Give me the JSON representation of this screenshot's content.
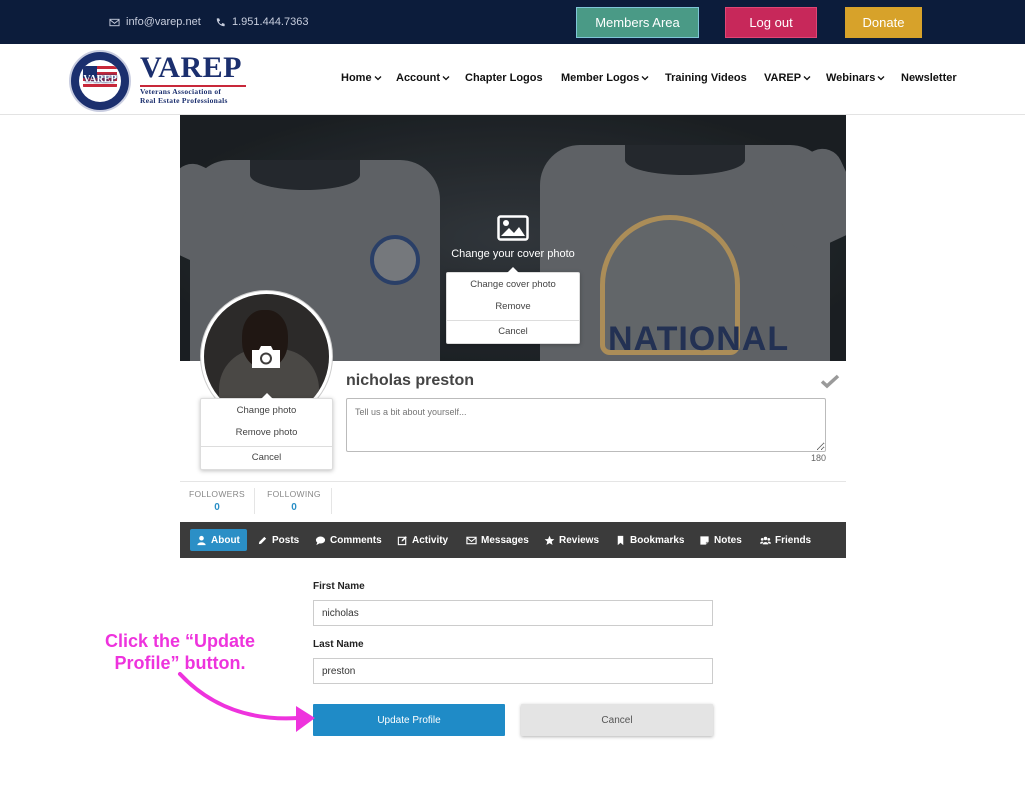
{
  "topbar": {
    "email": "info@varep.net",
    "phone": "1.951.444.7363",
    "members_label": "Members Area",
    "logout_label": "Log out",
    "donate_label": "Donate"
  },
  "logo": {
    "seal_word": "VAREP",
    "wordmark": "VAREP",
    "tagline_1": "Veterans Association of",
    "tagline_2": "Real Estate Professionals"
  },
  "nav": {
    "items": [
      {
        "label": "Home",
        "dropdown": true
      },
      {
        "label": "Account",
        "dropdown": true
      },
      {
        "label": "Chapter Logos",
        "dropdown": false
      },
      {
        "label": "Member Logos",
        "dropdown": true
      },
      {
        "label": "Training Videos",
        "dropdown": false
      },
      {
        "label": "VAREP",
        "dropdown": true
      },
      {
        "label": "Webinars",
        "dropdown": true
      },
      {
        "label": "Newsletter",
        "dropdown": false
      }
    ]
  },
  "cover": {
    "change_text": "Change your cover photo",
    "shirt_text": "NATIONAL",
    "menu": {
      "change": "Change cover photo",
      "remove": "Remove",
      "cancel": "Cancel"
    }
  },
  "photo_menu": {
    "change": "Change photo",
    "remove": "Remove photo",
    "cancel": "Cancel"
  },
  "profile": {
    "name": "nicholas preston",
    "bio_placeholder": "Tell us a bit about yourself...",
    "bio_remaining": "180",
    "followers_label": "FOLLOWERS",
    "followers_count": "0",
    "following_label": "FOLLOWING",
    "following_count": "0"
  },
  "tabs": [
    {
      "label": "About",
      "icon": "user-icon",
      "active": true
    },
    {
      "label": "Posts",
      "icon": "pencil-icon",
      "active": false
    },
    {
      "label": "Comments",
      "icon": "comment-icon",
      "active": false
    },
    {
      "label": "Activity",
      "icon": "edit-icon",
      "active": false
    },
    {
      "label": "Messages",
      "icon": "envelope-icon",
      "active": false
    },
    {
      "label": "Reviews",
      "icon": "star-icon",
      "active": false
    },
    {
      "label": "Bookmarks",
      "icon": "bookmark-icon",
      "active": false
    },
    {
      "label": "Notes",
      "icon": "note-icon",
      "active": false
    },
    {
      "label": "Friends",
      "icon": "users-icon",
      "active": false
    }
  ],
  "form": {
    "first_name_label": "First Name",
    "first_name_value": "nicholas",
    "last_name_label": "Last Name",
    "last_name_value": "preston",
    "update_label": "Update Profile",
    "cancel_label": "Cancel"
  },
  "annotation": {
    "line1": "Click the “Update",
    "line2": "Profile” button."
  },
  "colors": {
    "topbar": "#0c1c3b",
    "members": "#4a9a86",
    "logout": "#c7285a",
    "donate": "#d7a22a",
    "accent": "#1f8bc7",
    "annotation": "#ee33dd"
  }
}
